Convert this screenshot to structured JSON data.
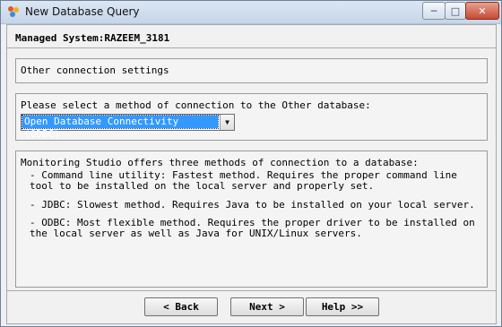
{
  "window": {
    "title": "New Database Query",
    "controls": {
      "minimize": "─",
      "maximize": "□",
      "close": "✕"
    }
  },
  "header": {
    "managed_system": "Managed System:RAZEEM_3181"
  },
  "section_title": "Other connection settings",
  "connection": {
    "prompt": "Please select a method of connection to the Other database:",
    "selected": "Open Database Connectivity (ODBC)",
    "arrow": "▼"
  },
  "info": {
    "intro": "Monitoring Studio offers three methods of connection to a database:",
    "items": [
      "- Command line utility: Fastest method. Requires the proper command line\ntool to be installed on the local server and properly set.",
      "- JDBC: Slowest method. Requires Java to be installed on your local server.",
      "- ODBC: Most flexible method. Requires the proper driver to be installed on\nthe local server as well as Java for UNIX/Linux servers."
    ]
  },
  "buttons": {
    "back": "< Back",
    "next": "Next >",
    "help": "Help >>"
  },
  "colors": {
    "selection": "#3399ff",
    "titlebar": "#c6d5e8",
    "close": "#c64a32"
  }
}
